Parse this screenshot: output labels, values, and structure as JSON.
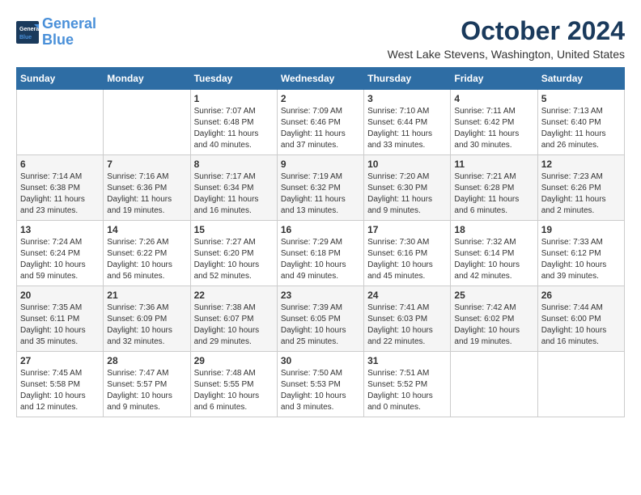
{
  "logo": {
    "line1": "General",
    "line2": "Blue"
  },
  "title": "October 2024",
  "location": "West Lake Stevens, Washington, United States",
  "days_of_week": [
    "Sunday",
    "Monday",
    "Tuesday",
    "Wednesday",
    "Thursday",
    "Friday",
    "Saturday"
  ],
  "weeks": [
    [
      {
        "day": "",
        "info": ""
      },
      {
        "day": "",
        "info": ""
      },
      {
        "day": "1",
        "info": "Sunrise: 7:07 AM\nSunset: 6:48 PM\nDaylight: 11 hours and 40 minutes."
      },
      {
        "day": "2",
        "info": "Sunrise: 7:09 AM\nSunset: 6:46 PM\nDaylight: 11 hours and 37 minutes."
      },
      {
        "day": "3",
        "info": "Sunrise: 7:10 AM\nSunset: 6:44 PM\nDaylight: 11 hours and 33 minutes."
      },
      {
        "day": "4",
        "info": "Sunrise: 7:11 AM\nSunset: 6:42 PM\nDaylight: 11 hours and 30 minutes."
      },
      {
        "day": "5",
        "info": "Sunrise: 7:13 AM\nSunset: 6:40 PM\nDaylight: 11 hours and 26 minutes."
      }
    ],
    [
      {
        "day": "6",
        "info": "Sunrise: 7:14 AM\nSunset: 6:38 PM\nDaylight: 11 hours and 23 minutes."
      },
      {
        "day": "7",
        "info": "Sunrise: 7:16 AM\nSunset: 6:36 PM\nDaylight: 11 hours and 19 minutes."
      },
      {
        "day": "8",
        "info": "Sunrise: 7:17 AM\nSunset: 6:34 PM\nDaylight: 11 hours and 16 minutes."
      },
      {
        "day": "9",
        "info": "Sunrise: 7:19 AM\nSunset: 6:32 PM\nDaylight: 11 hours and 13 minutes."
      },
      {
        "day": "10",
        "info": "Sunrise: 7:20 AM\nSunset: 6:30 PM\nDaylight: 11 hours and 9 minutes."
      },
      {
        "day": "11",
        "info": "Sunrise: 7:21 AM\nSunset: 6:28 PM\nDaylight: 11 hours and 6 minutes."
      },
      {
        "day": "12",
        "info": "Sunrise: 7:23 AM\nSunset: 6:26 PM\nDaylight: 11 hours and 2 minutes."
      }
    ],
    [
      {
        "day": "13",
        "info": "Sunrise: 7:24 AM\nSunset: 6:24 PM\nDaylight: 10 hours and 59 minutes."
      },
      {
        "day": "14",
        "info": "Sunrise: 7:26 AM\nSunset: 6:22 PM\nDaylight: 10 hours and 56 minutes."
      },
      {
        "day": "15",
        "info": "Sunrise: 7:27 AM\nSunset: 6:20 PM\nDaylight: 10 hours and 52 minutes."
      },
      {
        "day": "16",
        "info": "Sunrise: 7:29 AM\nSunset: 6:18 PM\nDaylight: 10 hours and 49 minutes."
      },
      {
        "day": "17",
        "info": "Sunrise: 7:30 AM\nSunset: 6:16 PM\nDaylight: 10 hours and 45 minutes."
      },
      {
        "day": "18",
        "info": "Sunrise: 7:32 AM\nSunset: 6:14 PM\nDaylight: 10 hours and 42 minutes."
      },
      {
        "day": "19",
        "info": "Sunrise: 7:33 AM\nSunset: 6:12 PM\nDaylight: 10 hours and 39 minutes."
      }
    ],
    [
      {
        "day": "20",
        "info": "Sunrise: 7:35 AM\nSunset: 6:11 PM\nDaylight: 10 hours and 35 minutes."
      },
      {
        "day": "21",
        "info": "Sunrise: 7:36 AM\nSunset: 6:09 PM\nDaylight: 10 hours and 32 minutes."
      },
      {
        "day": "22",
        "info": "Sunrise: 7:38 AM\nSunset: 6:07 PM\nDaylight: 10 hours and 29 minutes."
      },
      {
        "day": "23",
        "info": "Sunrise: 7:39 AM\nSunset: 6:05 PM\nDaylight: 10 hours and 25 minutes."
      },
      {
        "day": "24",
        "info": "Sunrise: 7:41 AM\nSunset: 6:03 PM\nDaylight: 10 hours and 22 minutes."
      },
      {
        "day": "25",
        "info": "Sunrise: 7:42 AM\nSunset: 6:02 PM\nDaylight: 10 hours and 19 minutes."
      },
      {
        "day": "26",
        "info": "Sunrise: 7:44 AM\nSunset: 6:00 PM\nDaylight: 10 hours and 16 minutes."
      }
    ],
    [
      {
        "day": "27",
        "info": "Sunrise: 7:45 AM\nSunset: 5:58 PM\nDaylight: 10 hours and 12 minutes."
      },
      {
        "day": "28",
        "info": "Sunrise: 7:47 AM\nSunset: 5:57 PM\nDaylight: 10 hours and 9 minutes."
      },
      {
        "day": "29",
        "info": "Sunrise: 7:48 AM\nSunset: 5:55 PM\nDaylight: 10 hours and 6 minutes."
      },
      {
        "day": "30",
        "info": "Sunrise: 7:50 AM\nSunset: 5:53 PM\nDaylight: 10 hours and 3 minutes."
      },
      {
        "day": "31",
        "info": "Sunrise: 7:51 AM\nSunset: 5:52 PM\nDaylight: 10 hours and 0 minutes."
      },
      {
        "day": "",
        "info": ""
      },
      {
        "day": "",
        "info": ""
      }
    ]
  ]
}
